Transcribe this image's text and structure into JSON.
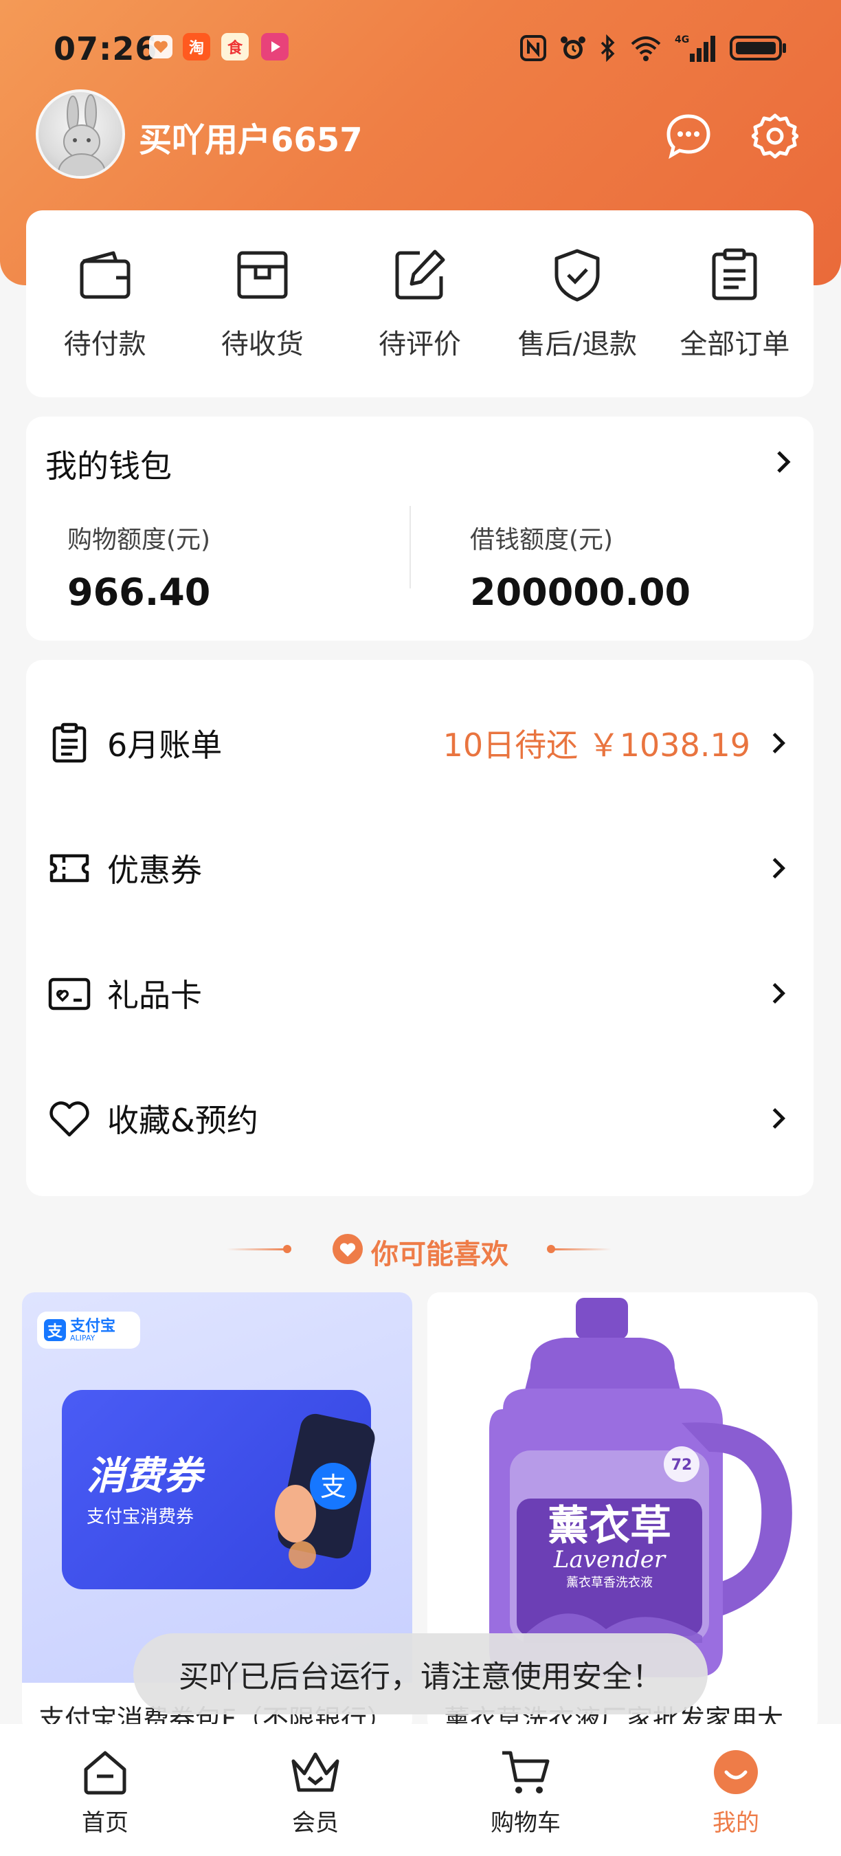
{
  "status_bar": {
    "time": "07:26",
    "app_icons": [
      "heart-icon",
      "taobao-icon",
      "food-delivery-icon",
      "video-icon"
    ],
    "right_icons": [
      "nfc-icon",
      "alarm-icon",
      "bluetooth-icon",
      "wifi-icon",
      "signal-4g-icon",
      "battery-icon"
    ],
    "network_label": "4G"
  },
  "profile": {
    "username": "买吖用户6657"
  },
  "orders": [
    {
      "label": "待付款",
      "icon": "wallet-icon"
    },
    {
      "label": "待收货",
      "icon": "package-icon"
    },
    {
      "label": "待评价",
      "icon": "edit-icon"
    },
    {
      "label": "售后/退款",
      "icon": "shield-icon"
    },
    {
      "label": "全部订单",
      "icon": "clipboard-icon"
    }
  ],
  "wallet": {
    "title": "我的钱包",
    "shopping_label": "购物额度(元)",
    "shopping_value": "966.40",
    "loan_label": "借钱额度(元)",
    "loan_value": "200000.00"
  },
  "menu": [
    {
      "label": "6月账单",
      "extra": "10日待还 ￥1038.19",
      "icon": "bill-icon"
    },
    {
      "label": "优惠券",
      "extra": "",
      "icon": "coupon-icon"
    },
    {
      "label": "礼品卡",
      "extra": "",
      "icon": "gift-card-icon"
    },
    {
      "label": "收藏&预约",
      "extra": "",
      "icon": "heart-outline-icon"
    }
  ],
  "recommend": {
    "title": "你可能喜欢",
    "products": [
      {
        "name": "支付宝消费券包F（不限银行）",
        "badge": "支付宝",
        "badge_sub": "ALIPAY",
        "coupon_title": "消费券",
        "coupon_sub": "支付宝消费券"
      },
      {
        "name": "薰衣草洗衣液厂家批发家用大",
        "label_cn": "薰衣草",
        "label_en": "Lavender",
        "label_sub": "薰衣草香洗衣液",
        "badge_72": "72"
      }
    ]
  },
  "toast": {
    "text": "买吖已后台运行，请注意使用安全！"
  },
  "bottom_nav": [
    {
      "label": "首页",
      "icon": "home-icon",
      "active": false
    },
    {
      "label": "会员",
      "icon": "crown-icon",
      "active": false
    },
    {
      "label": "购物车",
      "icon": "cart-icon",
      "active": false
    },
    {
      "label": "我的",
      "icon": "profile-smile-icon",
      "active": true
    }
  ],
  "colors": {
    "accent": "#ee7c48",
    "header_start": "#f49a56",
    "header_end": "#ea6a3a",
    "page_bg": "#f6f6f6"
  }
}
